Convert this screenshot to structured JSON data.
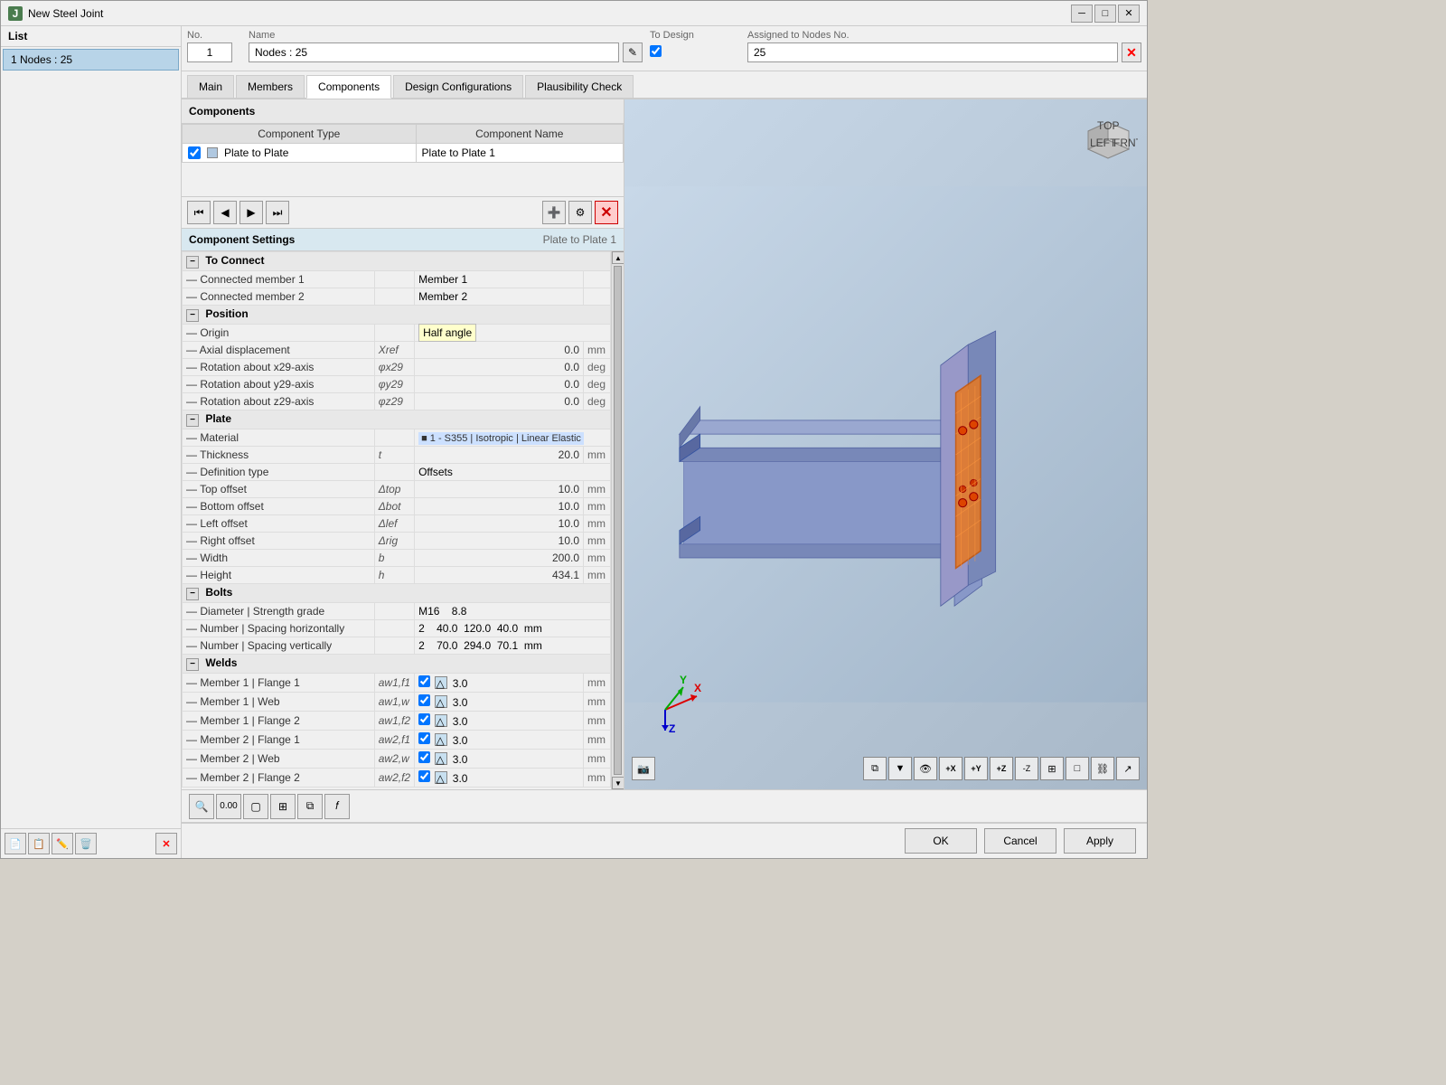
{
  "window": {
    "title": "New Steel Joint",
    "icon": "J"
  },
  "list_panel": {
    "title": "List",
    "items": [
      {
        "label": "1  Nodes : 25"
      }
    ]
  },
  "info_bar": {
    "no_label": "No.",
    "no_value": "1",
    "name_label": "Name",
    "name_value": "Nodes : 25",
    "to_design_label": "To Design",
    "assigned_label": "Assigned to Nodes No.",
    "assigned_value": "25"
  },
  "tabs": [
    {
      "label": "Main",
      "active": false
    },
    {
      "label": "Members",
      "active": false
    },
    {
      "label": "Components",
      "active": true
    },
    {
      "label": "Design Configurations",
      "active": false
    },
    {
      "label": "Plausibility Check",
      "active": false
    }
  ],
  "components": {
    "title": "Components",
    "table_headers": [
      "Component Type",
      "Component Name"
    ],
    "rows": [
      {
        "checked": true,
        "type": "Plate to Plate",
        "name": "Plate to Plate 1"
      }
    ]
  },
  "comp_settings": {
    "title": "Component Settings",
    "subtitle": "Plate to Plate 1",
    "sections": {
      "to_connect": {
        "label": "To Connect",
        "expanded": true,
        "rows": [
          {
            "label": "Connected member 1",
            "value": "Member 1"
          },
          {
            "label": "Connected member 2",
            "value": "Member 2"
          }
        ]
      },
      "position": {
        "label": "Position",
        "expanded": true,
        "rows": [
          {
            "label": "Origin",
            "value": "Half angle"
          },
          {
            "label": "Axial displacement",
            "symbol": "Xref",
            "value": "0.0",
            "unit": "mm"
          },
          {
            "label": "Rotation about x29-axis",
            "symbol": "φx29",
            "value": "0.0",
            "unit": "deg"
          },
          {
            "label": "Rotation about y29-axis",
            "symbol": "φy29",
            "value": "0.0",
            "unit": "deg"
          },
          {
            "label": "Rotation about z29-axis",
            "symbol": "φz29",
            "value": "0.0",
            "unit": "deg"
          }
        ]
      },
      "plate": {
        "label": "Plate",
        "expanded": true,
        "rows": [
          {
            "label": "Material",
            "value": "1 - S355 | Isotropic | Linear Elastic"
          },
          {
            "label": "Thickness",
            "symbol": "t",
            "value": "20.0",
            "unit": "mm"
          },
          {
            "label": "Definition type",
            "value": "Offsets"
          },
          {
            "label": "Top offset",
            "symbol": "Δtop",
            "value": "10.0",
            "unit": "mm"
          },
          {
            "label": "Bottom offset",
            "symbol": "Δbot",
            "value": "10.0",
            "unit": "mm"
          },
          {
            "label": "Left offset",
            "symbol": "Δlef",
            "value": "10.0",
            "unit": "mm"
          },
          {
            "label": "Right offset",
            "symbol": "Δrig",
            "value": "10.0",
            "unit": "mm"
          },
          {
            "label": "Width",
            "symbol": "b",
            "value": "200.0",
            "unit": "mm"
          },
          {
            "label": "Height",
            "symbol": "h",
            "value": "434.1",
            "unit": "mm"
          }
        ]
      },
      "bolts": {
        "label": "Bolts",
        "expanded": true,
        "rows": [
          {
            "label": "Diameter | Strength grade",
            "value": "M16    8.8"
          },
          {
            "label": "Number | Spacing horizontally",
            "value": "2     40.0  120.0  40.0  mm"
          },
          {
            "label": "Number | Spacing vertically",
            "value": "2     70.0  294.0  70.1  mm"
          }
        ]
      },
      "welds": {
        "label": "Welds",
        "expanded": true,
        "rows": [
          {
            "label": "Member 1 | Flange 1",
            "symbol": "aw1,f1",
            "value": "3.0",
            "unit": "mm"
          },
          {
            "label": "Member 1 | Web",
            "symbol": "aw1,w",
            "value": "3.0",
            "unit": "mm"
          },
          {
            "label": "Member 1 | Flange 2",
            "symbol": "aw1,f2",
            "value": "3.0",
            "unit": "mm"
          },
          {
            "label": "Member 2 | Flange 1",
            "symbol": "aw2,f1",
            "value": "3.0",
            "unit": "mm"
          },
          {
            "label": "Member 2 | Web",
            "symbol": "aw2,w",
            "value": "3.0",
            "unit": "mm"
          },
          {
            "label": "Member 2 | Flange 2",
            "symbol": "aw2,f2",
            "value": "3.0",
            "unit": "mm"
          }
        ]
      }
    }
  },
  "footer_buttons": {
    "ok": "OK",
    "cancel": "Cancel",
    "apply": "Apply"
  },
  "bottom_toolbar_icons": [
    "search",
    "decimal",
    "box",
    "grid",
    "layers",
    "settings"
  ],
  "view_toolbar": {
    "left_buttons": [
      "camera"
    ],
    "right_buttons": [
      "copy",
      "eye",
      "x-axis",
      "y-axis",
      "z-axis",
      "iz",
      "frame",
      "box-mode",
      "link",
      "export"
    ]
  }
}
